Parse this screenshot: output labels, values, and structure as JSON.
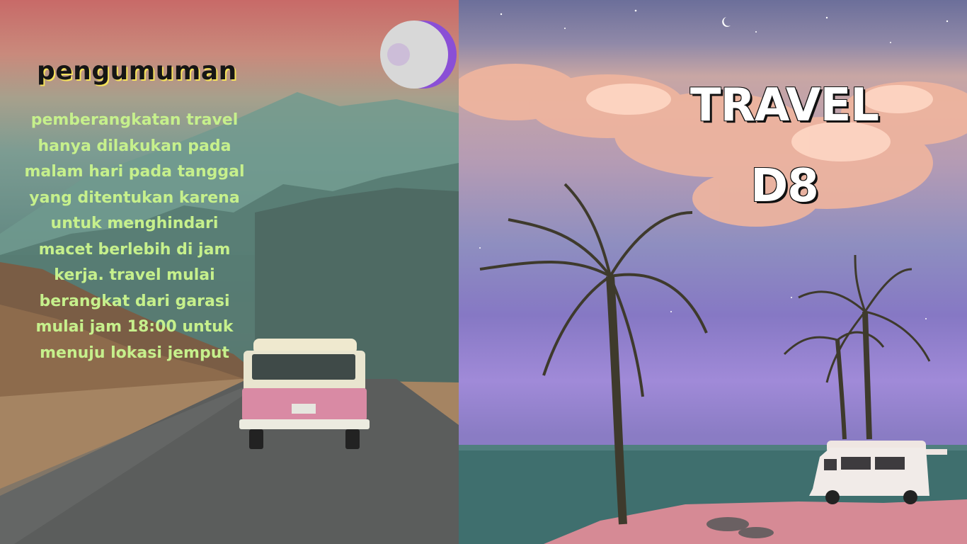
{
  "announcement": {
    "title": "pengumuman",
    "body": "pemberangkatan travel hanya dilakukan pada malam hari pada tanggal yang ditentukan karena untuk menghindari macet berlebih di jam kerja. travel mulai berangkat dari garasi mulai jam 18:00 untuk menuju lokasi jemput",
    "text_color": "#c6f08c",
    "title_shadow_color": "#f6e25b"
  },
  "brand": {
    "line1": "TRAVEL",
    "line2": "D8"
  },
  "icons": {
    "moon": "moon-decoration-icon"
  }
}
